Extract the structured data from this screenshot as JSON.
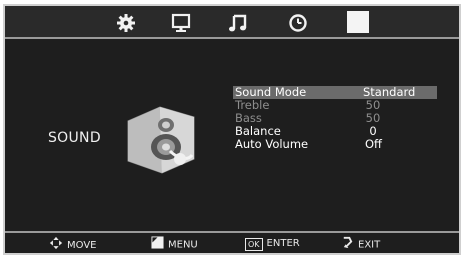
{
  "tabs": [
    {
      "icon": "gear-icon"
    },
    {
      "icon": "monitor-icon"
    },
    {
      "icon": "music-note-icon"
    },
    {
      "icon": "clock-icon"
    },
    {
      "icon": "selected-tab-icon"
    }
  ],
  "section_title": "SOUND",
  "menu": [
    {
      "label": "Sound  Mode",
      "value": "Standard",
      "selected": true,
      "dimmed": false
    },
    {
      "label": "Treble",
      "value": "50",
      "selected": false,
      "dimmed": true
    },
    {
      "label": "Bass",
      "value": "50",
      "selected": false,
      "dimmed": true
    },
    {
      "label": "Balance",
      "value": "0",
      "selected": false,
      "dimmed": false
    },
    {
      "label": "Auto  Volume",
      "value": "Off",
      "selected": false,
      "dimmed": false
    }
  ],
  "footer": {
    "move": "MOVE",
    "menu": "MENU",
    "enter": "ENTER",
    "exit": "EXIT",
    "ok_key": "OK"
  }
}
